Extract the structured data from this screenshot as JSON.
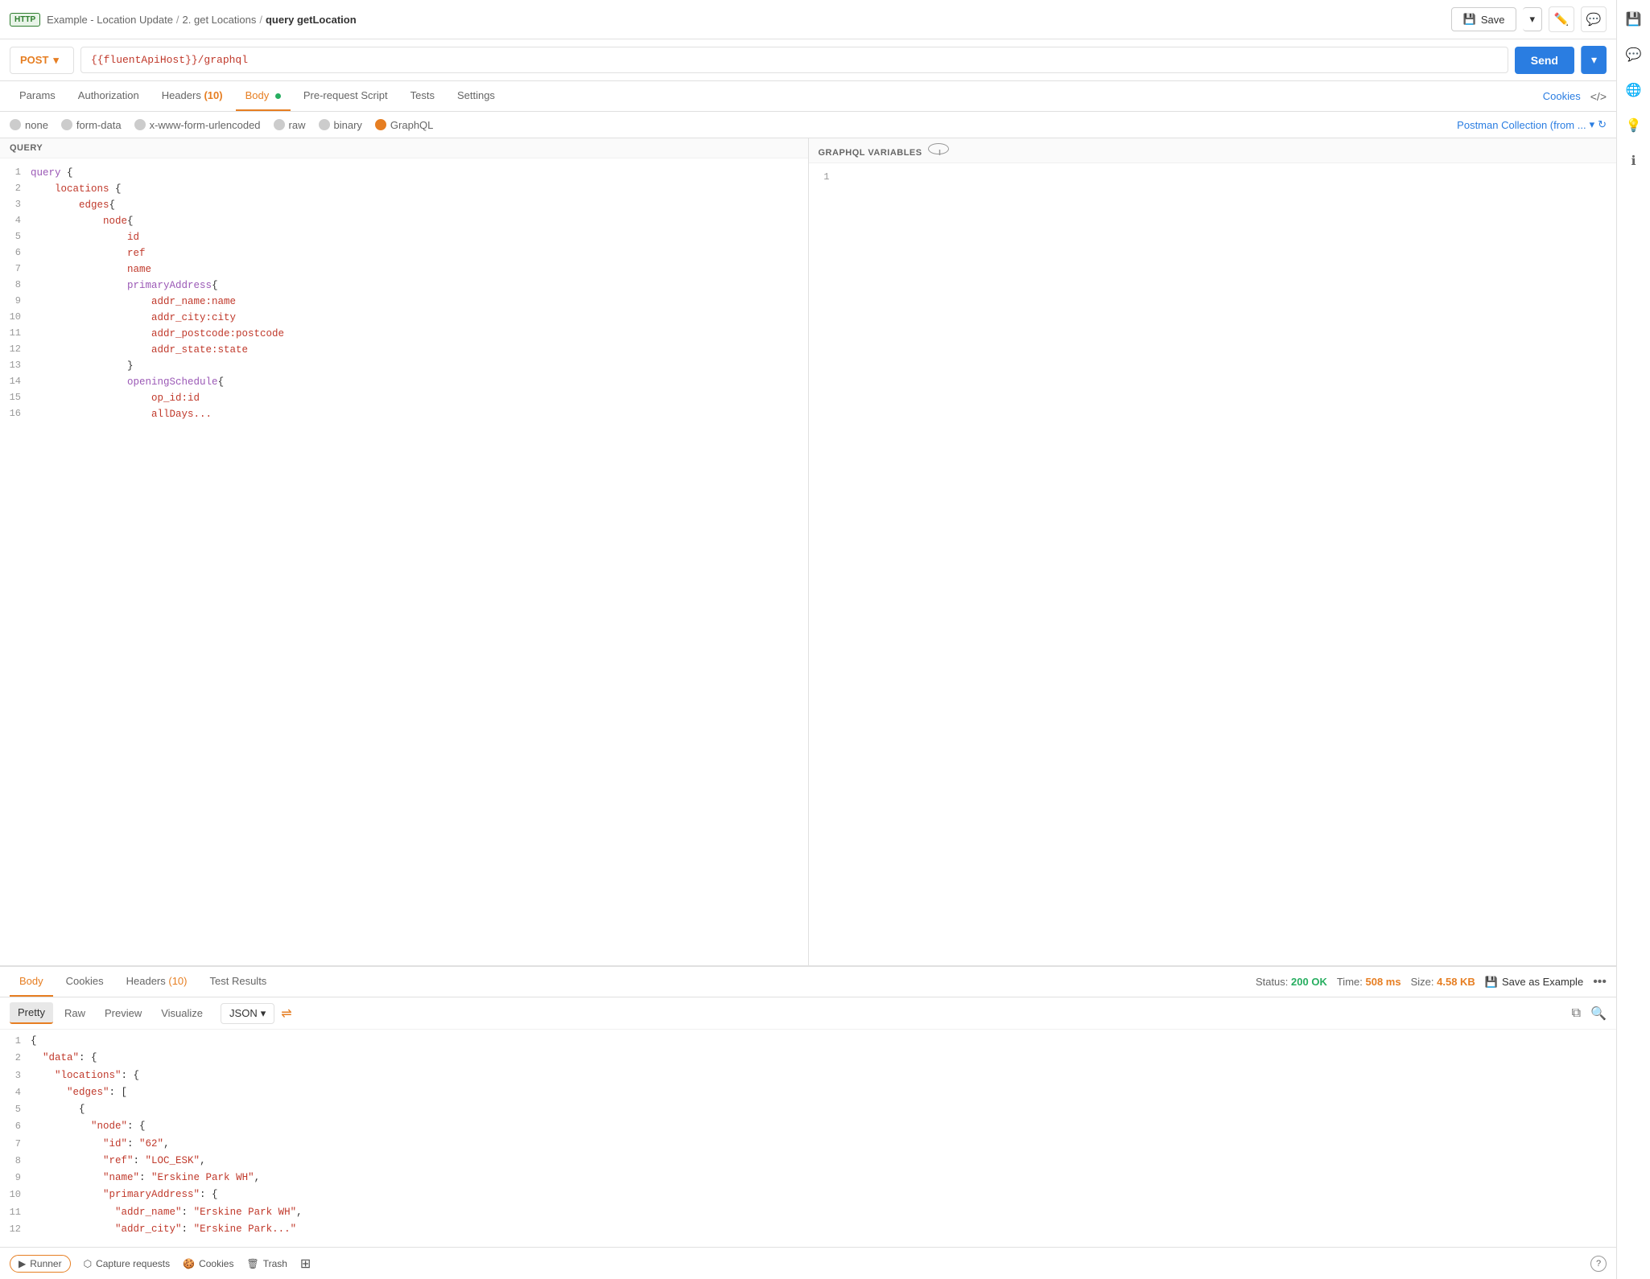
{
  "app": {
    "http_badge": "HTTP",
    "breadcrumb1": "Example - Location Update",
    "breadcrumb2": "2. get Locations",
    "breadcrumb3": "query getLocation",
    "save_label": "Save",
    "save_dropdown_icon": "▾"
  },
  "url_bar": {
    "method": "POST",
    "url": "{{fluentApiHost}}/graphql",
    "send_label": "Send"
  },
  "request_tabs": {
    "params": "Params",
    "authorization": "Authorization",
    "headers": "Headers",
    "headers_count": "(10)",
    "body": "Body",
    "pre_request": "Pre-request Script",
    "tests": "Tests",
    "settings": "Settings",
    "cookies": "Cookies"
  },
  "body_types": {
    "none": "none",
    "form_data": "form-data",
    "urlencoded": "x-www-form-urlencoded",
    "raw": "raw",
    "binary": "binary",
    "graphql": "GraphQL",
    "collection_link": "Postman Collection (from ..."
  },
  "query_editor": {
    "label": "QUERY",
    "lines": [
      {
        "num": 1,
        "content": "query {",
        "tokens": [
          {
            "text": "query",
            "cls": "kw"
          },
          {
            "text": " {",
            "cls": "punct"
          }
        ]
      },
      {
        "num": 2,
        "content": "    locations {",
        "tokens": [
          {
            "text": "    ",
            "cls": ""
          },
          {
            "text": "locations",
            "cls": "field"
          },
          {
            "text": " {",
            "cls": "punct"
          }
        ]
      },
      {
        "num": 3,
        "content": "        edges{",
        "tokens": [
          {
            "text": "        ",
            "cls": ""
          },
          {
            "text": "edges",
            "cls": "field"
          },
          {
            "text": "{",
            "cls": "punct"
          }
        ]
      },
      {
        "num": 4,
        "content": "            node{",
        "tokens": [
          {
            "text": "            ",
            "cls": ""
          },
          {
            "text": "node",
            "cls": "field"
          },
          {
            "text": "{",
            "cls": "punct"
          }
        ]
      },
      {
        "num": 5,
        "content": "                id",
        "tokens": [
          {
            "text": "                ",
            "cls": ""
          },
          {
            "text": "id",
            "cls": "field"
          }
        ]
      },
      {
        "num": 6,
        "content": "                ref",
        "tokens": [
          {
            "text": "                ",
            "cls": ""
          },
          {
            "text": "ref",
            "cls": "field"
          }
        ]
      },
      {
        "num": 7,
        "content": "                name",
        "tokens": [
          {
            "text": "                ",
            "cls": ""
          },
          {
            "text": "name",
            "cls": "field"
          }
        ]
      },
      {
        "num": 8,
        "content": "                primaryAddress{",
        "tokens": [
          {
            "text": "                ",
            "cls": ""
          },
          {
            "text": "primaryAddress",
            "cls": "prop"
          },
          {
            "text": "{",
            "cls": "punct"
          }
        ]
      },
      {
        "num": 9,
        "content": "                    addr_name:name",
        "tokens": [
          {
            "text": "                    ",
            "cls": ""
          },
          {
            "text": "addr_name:name",
            "cls": "field"
          }
        ]
      },
      {
        "num": 10,
        "content": "                    addr_city:city",
        "tokens": [
          {
            "text": "                    ",
            "cls": ""
          },
          {
            "text": "addr_city:city",
            "cls": "field"
          }
        ]
      },
      {
        "num": 11,
        "content": "                    addr_postcode:postcode",
        "tokens": [
          {
            "text": "                    ",
            "cls": ""
          },
          {
            "text": "addr_postcode:postcode",
            "cls": "field"
          }
        ]
      },
      {
        "num": 12,
        "content": "                    addr_state:state",
        "tokens": [
          {
            "text": "                    ",
            "cls": ""
          },
          {
            "text": "addr_state:state",
            "cls": "field"
          }
        ]
      },
      {
        "num": 13,
        "content": "                }",
        "tokens": [
          {
            "text": "                }",
            "cls": "punct"
          }
        ]
      },
      {
        "num": 14,
        "content": "                openingSchedule{",
        "tokens": [
          {
            "text": "                ",
            "cls": ""
          },
          {
            "text": "openingSchedule",
            "cls": "prop"
          },
          {
            "text": "{",
            "cls": "punct"
          }
        ]
      },
      {
        "num": 15,
        "content": "                    op_id:id",
        "tokens": [
          {
            "text": "                    ",
            "cls": ""
          },
          {
            "text": "op_id:id",
            "cls": "field"
          }
        ]
      },
      {
        "num": 16,
        "content": "                    allDays",
        "tokens": [
          {
            "text": "                    ",
            "cls": ""
          },
          {
            "text": "allDays...",
            "cls": "field"
          }
        ]
      }
    ]
  },
  "variables_editor": {
    "label": "GRAPHQL VARIABLES",
    "lines": [
      {
        "num": 1,
        "content": ""
      }
    ]
  },
  "response": {
    "tabs": {
      "body": "Body",
      "cookies": "Cookies",
      "headers": "Headers",
      "headers_count": "(10)",
      "test_results": "Test Results"
    },
    "status": "Status:",
    "status_val": "200 OK",
    "time": "Time:",
    "time_val": "508 ms",
    "size": "Size:",
    "size_val": "4.58 KB",
    "save_example": "Save as Example",
    "format_tabs": {
      "pretty": "Pretty",
      "raw": "Raw",
      "preview": "Preview",
      "visualize": "Visualize"
    },
    "format_select": "JSON",
    "json_lines": [
      {
        "num": 1,
        "content": "{",
        "tokens": [
          {
            "text": "{",
            "cls": "json-bracket"
          }
        ]
      },
      {
        "num": 2,
        "content": "  \"data\": {",
        "tokens": [
          {
            "text": "  ",
            "cls": ""
          },
          {
            "text": "\"data\"",
            "cls": "json-key"
          },
          {
            "text": ": {",
            "cls": "json-bracket"
          }
        ]
      },
      {
        "num": 3,
        "content": "    \"locations\": {",
        "tokens": [
          {
            "text": "    ",
            "cls": ""
          },
          {
            "text": "\"locations\"",
            "cls": "json-key"
          },
          {
            "text": ": {",
            "cls": "json-bracket"
          }
        ]
      },
      {
        "num": 4,
        "content": "      \"edges\": [",
        "tokens": [
          {
            "text": "      ",
            "cls": ""
          },
          {
            "text": "\"edges\"",
            "cls": "json-key"
          },
          {
            "text": ": [",
            "cls": "json-bracket"
          }
        ]
      },
      {
        "num": 5,
        "content": "        {",
        "tokens": [
          {
            "text": "        {",
            "cls": "json-bracket"
          }
        ]
      },
      {
        "num": 6,
        "content": "          \"node\": {",
        "tokens": [
          {
            "text": "          ",
            "cls": ""
          },
          {
            "text": "\"node\"",
            "cls": "json-key"
          },
          {
            "text": ": {",
            "cls": "json-bracket"
          }
        ]
      },
      {
        "num": 7,
        "content": "            \"id\": \"62\",",
        "tokens": [
          {
            "text": "            ",
            "cls": ""
          },
          {
            "text": "\"id\"",
            "cls": "json-key"
          },
          {
            "text": ": ",
            "cls": ""
          },
          {
            "text": "\"62\"",
            "cls": "json-str"
          },
          {
            "text": ",",
            "cls": ""
          }
        ]
      },
      {
        "num": 8,
        "content": "            \"ref\": \"LOC_ESK\",",
        "tokens": [
          {
            "text": "            ",
            "cls": ""
          },
          {
            "text": "\"ref\"",
            "cls": "json-key"
          },
          {
            "text": ": ",
            "cls": ""
          },
          {
            "text": "\"LOC_ESK\"",
            "cls": "json-str"
          },
          {
            "text": ",",
            "cls": ""
          }
        ]
      },
      {
        "num": 9,
        "content": "            \"name\": \"Erskine Park WH\",",
        "tokens": [
          {
            "text": "            ",
            "cls": ""
          },
          {
            "text": "\"name\"",
            "cls": "json-key"
          },
          {
            "text": ": ",
            "cls": ""
          },
          {
            "text": "\"Erskine Park WH\"",
            "cls": "json-str"
          },
          {
            "text": ",",
            "cls": ""
          }
        ]
      },
      {
        "num": 10,
        "content": "            \"primaryAddress\": {",
        "tokens": [
          {
            "text": "            ",
            "cls": ""
          },
          {
            "text": "\"primaryAddress\"",
            "cls": "json-key"
          },
          {
            "text": ": {",
            "cls": "json-bracket"
          }
        ]
      },
      {
        "num": 11,
        "content": "              \"addr_name\": \"Erskine Park WH\",",
        "tokens": [
          {
            "text": "              ",
            "cls": ""
          },
          {
            "text": "\"addr_name\"",
            "cls": "json-key"
          },
          {
            "text": ": ",
            "cls": ""
          },
          {
            "text": "\"Erskine Park WH\"",
            "cls": "json-str"
          },
          {
            "text": ",",
            "cls": ""
          }
        ]
      },
      {
        "num": 12,
        "content": "              \"addr_city\": \"Erskine Park...",
        "tokens": [
          {
            "text": "              ",
            "cls": ""
          },
          {
            "text": "\"addr_city\"",
            "cls": "json-key"
          },
          {
            "text": ": ",
            "cls": ""
          },
          {
            "text": "\"Erskine Park...\"",
            "cls": "json-str"
          }
        ]
      }
    ]
  },
  "bottom_bar": {
    "runner": "Runner",
    "capture": "Capture requests",
    "cookies": "Cookies",
    "trash": "Trash",
    "help": "?"
  },
  "right_sidebar": {
    "icons": [
      "save-icon",
      "comment-icon",
      "browse-icon",
      "lightbulb-icon",
      "info-icon"
    ]
  }
}
